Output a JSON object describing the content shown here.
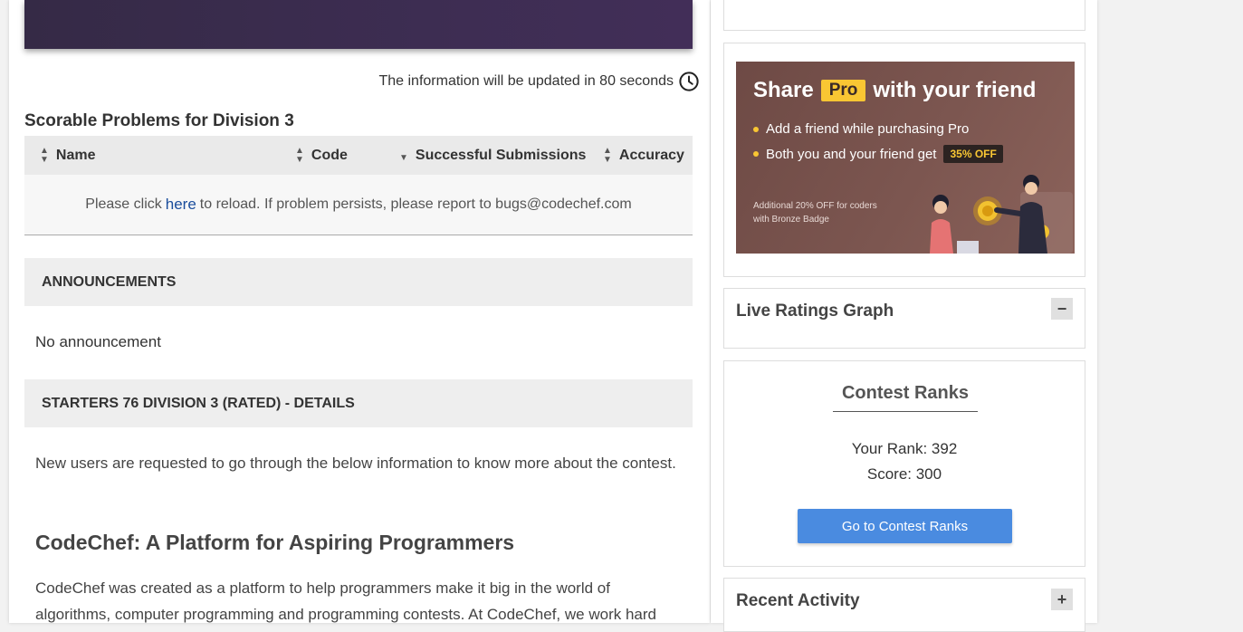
{
  "info_update": {
    "text": "The information will be updated in 80 seconds"
  },
  "problems": {
    "title": "Scorable Problems for Division 3",
    "columns": [
      "Name",
      "Code",
      "Successful Submissions",
      "Accuracy"
    ],
    "message_before": "Please click",
    "message_link": "here",
    "message_after": "to reload. If problem persists, please report to bugs@codechef.com"
  },
  "announcements": {
    "heading": "ANNOUNCEMENTS",
    "body": "No announcement"
  },
  "details": {
    "heading": "STARTERS 76 DIVISION 3 (RATED) - DETAILS",
    "intro": "New users are requested to go through the below information to know more about the contest.",
    "subheading": "CodeChef: A Platform for Aspiring Programmers",
    "paragraph": "CodeChef was created as a platform to help programmers make it big in the world of algorithms, computer programming and programming contests. At CodeChef, we work hard"
  },
  "promo": {
    "title_pre": "Share",
    "title_tag": "Pro",
    "title_post": "with your friend",
    "bullet1": "Add a friend while purchasing Pro",
    "bullet2": "Both you and your friend get",
    "off_tag": "35% OFF",
    "small_line1": "Additional 20% OFF for coders",
    "small_line2": "with Bronze Badge",
    "colors": {
      "background": "#7c5650",
      "accent": "#f9c633"
    }
  },
  "live_ratings": {
    "title": "Live Ratings Graph",
    "toggle": "−"
  },
  "contest_ranks": {
    "title": "Contest Ranks",
    "your_rank": "Your Rank: 392",
    "score": "Score: 300",
    "button": "Go to Contest Ranks",
    "button_color": "#4a8be0"
  },
  "recent_activity": {
    "title": "Recent Activity",
    "toggle": "+"
  }
}
